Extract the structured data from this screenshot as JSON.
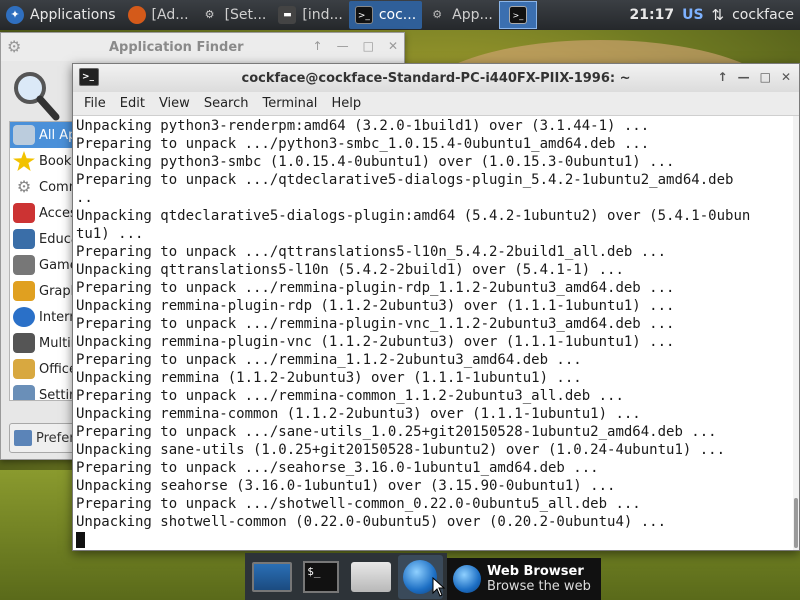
{
  "panel": {
    "apps_label": "Applications",
    "tasks": [
      {
        "label": "[Ad...",
        "icon": "firefox-icon"
      },
      {
        "label": "[Set...",
        "icon": "gear-icon"
      },
      {
        "label": "[ind...",
        "icon": "terminal-icon"
      },
      {
        "label": "coc...",
        "icon": "terminal-icon"
      },
      {
        "label": "App...",
        "icon": "app-finder-icon"
      }
    ],
    "clock": "21:17",
    "lang": "US",
    "user": "cockface"
  },
  "finder": {
    "title": "Application Finder",
    "categories": [
      "All Applications",
      "Bookmarks",
      "Commands",
      "Accessories",
      "Education",
      "Games",
      "Graphics",
      "Internet",
      "Multimedia",
      "Office",
      "Settings"
    ],
    "preferences_label": "Preferences"
  },
  "terminal": {
    "title": "cockface@cockface-Standard-PC-i440FX-PIIX-1996: ~",
    "menu": [
      "File",
      "Edit",
      "View",
      "Search",
      "Terminal",
      "Help"
    ],
    "lines": [
      "Unpacking python3-renderpm:amd64 (3.2.0-1build1) over (3.1.44-1) ...",
      "Preparing to unpack .../python3-smbc_1.0.15.4-0ubuntu1_amd64.deb ...",
      "Unpacking python3-smbc (1.0.15.4-0ubuntu1) over (1.0.15.3-0ubuntu1) ...",
      "Preparing to unpack .../qtdeclarative5-dialogs-plugin_5.4.2-1ubuntu2_amd64.deb",
      "..",
      "Unpacking qtdeclarative5-dialogs-plugin:amd64 (5.4.2-1ubuntu2) over (5.4.1-0ubun",
      "tu1) ...",
      "Preparing to unpack .../qttranslations5-l10n_5.4.2-2build1_all.deb ...",
      "Unpacking qttranslations5-l10n (5.4.2-2build1) over (5.4.1-1) ...",
      "Preparing to unpack .../remmina-plugin-rdp_1.1.2-2ubuntu3_amd64.deb ...",
      "Unpacking remmina-plugin-rdp (1.1.2-2ubuntu3) over (1.1.1-1ubuntu1) ...",
      "Preparing to unpack .../remmina-plugin-vnc_1.1.2-2ubuntu3_amd64.deb ...",
      "Unpacking remmina-plugin-vnc (1.1.2-2ubuntu3) over (1.1.1-1ubuntu1) ...",
      "Preparing to unpack .../remmina_1.1.2-2ubuntu3_amd64.deb ...",
      "Unpacking remmina (1.1.2-2ubuntu3) over (1.1.1-1ubuntu1) ...",
      "Preparing to unpack .../remmina-common_1.1.2-2ubuntu3_all.deb ...",
      "Unpacking remmina-common (1.1.2-2ubuntu3) over (1.1.1-1ubuntu1) ...",
      "Preparing to unpack .../sane-utils_1.0.25+git20150528-1ubuntu2_amd64.deb ...",
      "Unpacking sane-utils (1.0.25+git20150528-1ubuntu2) over (1.0.24-4ubuntu1) ...",
      "Preparing to unpack .../seahorse_3.16.0-1ubuntu1_amd64.deb ...",
      "Unpacking seahorse (3.16.0-1ubuntu1) over (3.15.90-0ubuntu1) ...",
      "Preparing to unpack .../shotwell-common_0.22.0-0ubuntu5_all.deb ...",
      "Unpacking shotwell-common (0.22.0-0ubuntu5) over (0.20.2-0ubuntu4) ..."
    ]
  },
  "dock": {
    "items": [
      "show-desktop-icon",
      "terminal-icon",
      "home-folder-icon",
      "web-browser-icon"
    ]
  },
  "tooltip": {
    "title": "Web Browser",
    "subtitle": "Browse the web"
  }
}
